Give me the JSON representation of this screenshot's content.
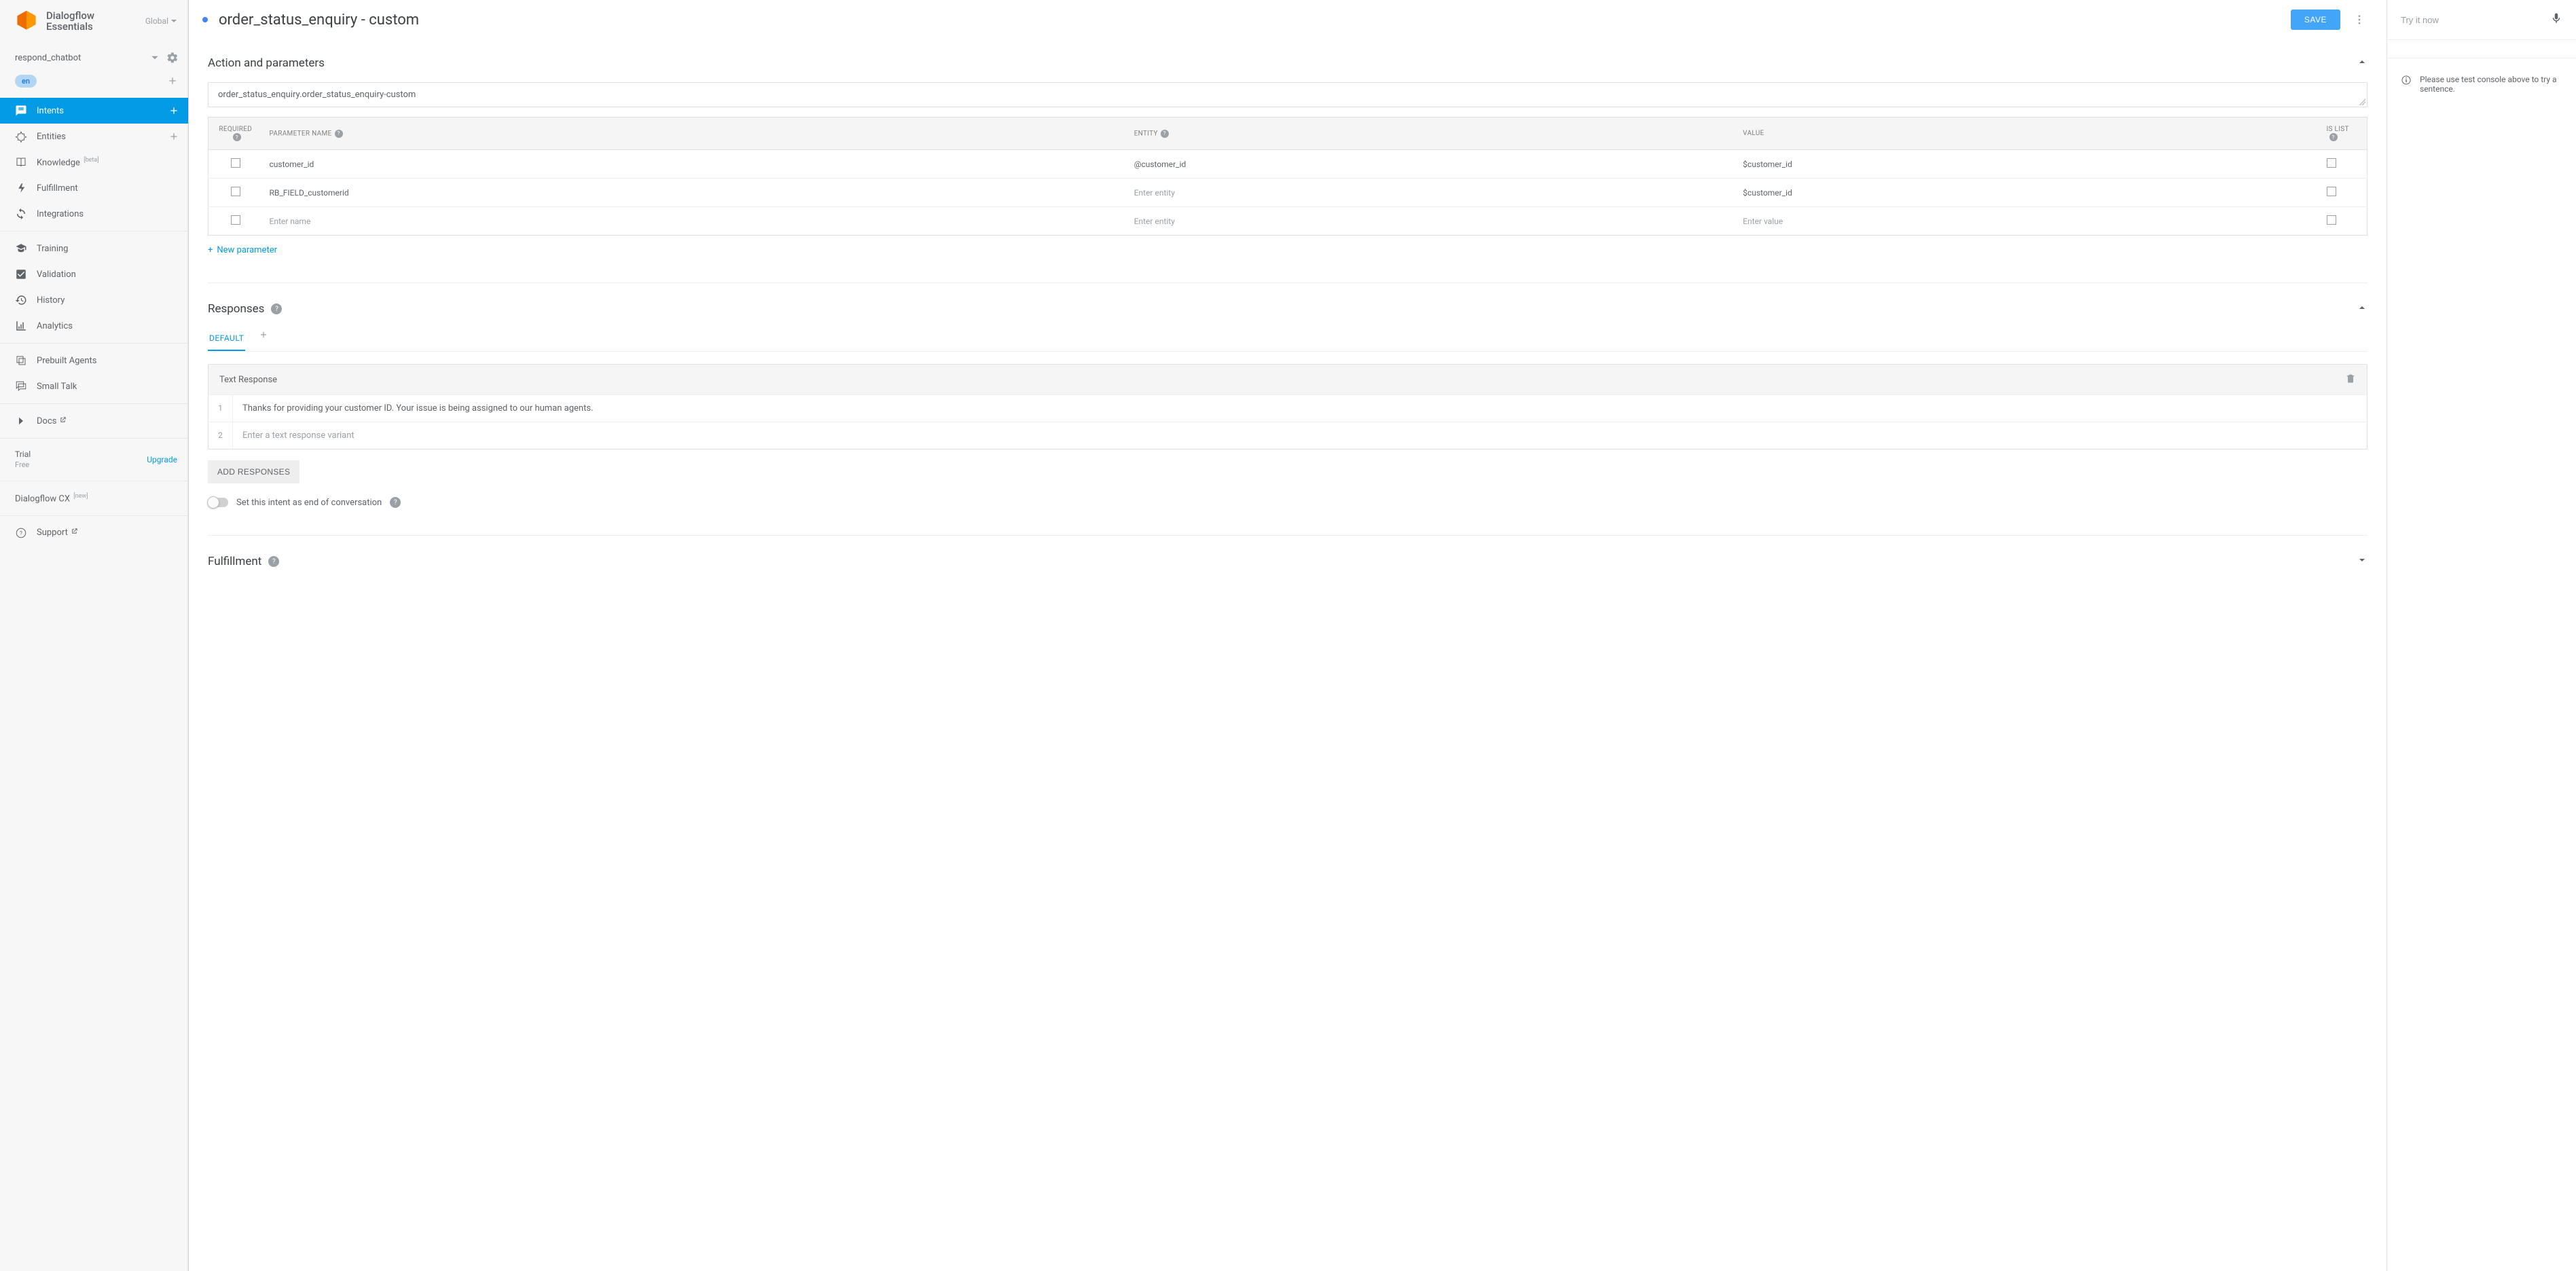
{
  "brand": {
    "line1": "Dialogflow",
    "line2": "Essentials",
    "global": "Global"
  },
  "agent": {
    "name": "respond_chatbot",
    "lang": "en"
  },
  "nav": {
    "intents": "Intents",
    "entities": "Entities",
    "knowledge": "Knowledge",
    "knowledge_badge": "[beta]",
    "fulfillment": "Fulfillment",
    "integrations": "Integrations",
    "training": "Training",
    "validation": "Validation",
    "history": "History",
    "analytics": "Analytics",
    "prebuilt": "Prebuilt Agents",
    "smalltalk": "Small Talk",
    "docs": "Docs",
    "cx": "Dialogflow CX",
    "cx_badge": "[new]",
    "support": "Support"
  },
  "plan": {
    "name": "Trial",
    "tier": "Free",
    "upgrade": "Upgrade"
  },
  "intent": {
    "title": "order_status_enquiry - custom",
    "save": "SAVE"
  },
  "sections": {
    "action": {
      "title": "Action and parameters",
      "action_name": "order_status_enquiry.order_status_enquiry-custom",
      "new_param": "New parameter"
    },
    "responses": {
      "title": "Responses",
      "default_tab": "DEFAULT",
      "text_response": "Text Response",
      "add": "ADD RESPONSES",
      "end": "Set this intent as end of conversation",
      "placeholder": "Enter a text response variant"
    },
    "fulfillment": {
      "title": "Fulfillment"
    }
  },
  "params": {
    "headers": {
      "required": "REQUIRED",
      "name": "PARAMETER NAME",
      "entity": "ENTITY",
      "value": "VALUE",
      "islist": "IS LIST"
    },
    "rows": [
      {
        "name": "customer_id",
        "entity": "@customer_id",
        "value": "$customer_id"
      },
      {
        "name": "RB_FIELD_customerid",
        "entity": "",
        "value": "$customer_id"
      }
    ],
    "placeholders": {
      "name": "Enter name",
      "entity": "Enter entity",
      "value": "Enter value"
    }
  },
  "responses": {
    "rows": [
      {
        "idx": "1",
        "text": "Thanks for providing your customer ID. Your issue is being assigned to our human agents."
      },
      {
        "idx": "2",
        "text": ""
      }
    ]
  },
  "tryit": {
    "placeholder": "Try it now",
    "hint": "Please use test console above to try a sentence."
  }
}
